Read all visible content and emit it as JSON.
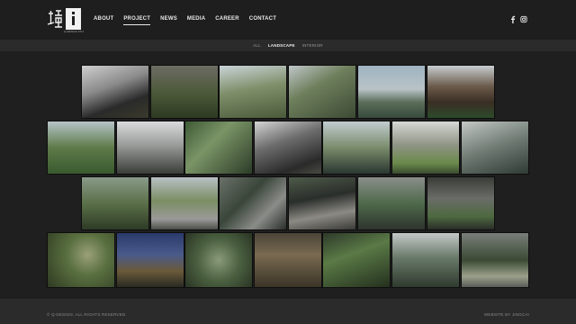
{
  "header": {
    "logo_subtext": "Q-DESIGN STUDIO",
    "nav": [
      {
        "label": "ABOUT",
        "active": false
      },
      {
        "label": "PROJECT",
        "active": true
      },
      {
        "label": "NEWS",
        "active": false
      },
      {
        "label": "MEDIA",
        "active": false
      },
      {
        "label": "CAREER",
        "active": false
      },
      {
        "label": "CONTACT",
        "active": false
      }
    ],
    "social": [
      "facebook-icon",
      "instagram-icon"
    ]
  },
  "filters": [
    {
      "label": "ALL",
      "active": false
    },
    {
      "label": "LANDSCAPE",
      "active": true
    },
    {
      "label": "INTERIOR",
      "active": false
    }
  ],
  "gallery": {
    "rows": [
      [
        {
          "name": "project-tile-1",
          "bg": "linear-gradient(160deg,#cfcfcf 0%,#8a8a8a 40%,#2a2a2a 70%,#3a3a2c 100%)"
        },
        {
          "name": "project-tile-2",
          "bg": "linear-gradient(180deg,#6c6c64 0%,#4d5a3a 50%,#2d3a22 100%)"
        },
        {
          "name": "project-tile-3",
          "bg": "linear-gradient(170deg,#c9d4d8 0%,#7f8f6a 45%,#4a5a3a 100%)"
        },
        {
          "name": "project-tile-4",
          "bg": "linear-gradient(150deg,#bfc6c8 0%,#6e7f5c 40%,#3c4a34 100%)"
        },
        {
          "name": "project-tile-5",
          "bg": "linear-gradient(180deg,#9fb3c2 0%,#b8c3c6 45%,#5a6e5a 70%,#384a3c 100%)"
        },
        {
          "name": "project-tile-6",
          "bg": "linear-gradient(180deg,#c7cdd0 0%,#6a5a4a 40%,#3a2e24 70%,#2d4a2a 100%)"
        }
      ],
      [
        {
          "name": "project-tile-7",
          "bg": "linear-gradient(180deg,#b6c4c8 0%,#5e7a4a 50%,#3a5a2e 100%)"
        },
        {
          "name": "project-tile-8",
          "bg": "linear-gradient(180deg,#d9dcdc 0%,#9a9c9a 45%,#3a3c38 100%)"
        },
        {
          "name": "project-tile-9",
          "bg": "linear-gradient(135deg,#3e5a36 0%,#7a9466 40%,#2c3c28 100%)"
        },
        {
          "name": "project-tile-10",
          "bg": "linear-gradient(160deg,#d4d4d4 0%,#6c6c6c 40%,#2a2a2a 80%,#4a4a44 100%)"
        },
        {
          "name": "project-tile-11",
          "bg": "linear-gradient(180deg,#c2ccd0 0%,#7a8c6c 50%,#2a3630 100%)"
        },
        {
          "name": "project-tile-12",
          "bg": "linear-gradient(180deg,#d6d8d4 0%,#8f9486 45%,#6a8a4a 80%,#3a4a30 100%)"
        },
        {
          "name": "project-tile-13",
          "bg": "linear-gradient(160deg,#c4c8c6 0%,#6e7a72 50%,#2e3a34 100%)"
        }
      ],
      [
        {
          "name": "project-tile-14",
          "bg": "linear-gradient(180deg,#8a9a8a 0%,#5a7048 50%,#2e3a26 100%)"
        },
        {
          "name": "project-tile-15",
          "bg": "linear-gradient(180deg,#b8c0c4 0%,#7a8e64 45%,#9a9a98 80%,#4a4e48 100%)"
        },
        {
          "name": "project-tile-16",
          "bg": "linear-gradient(135deg,#6a7068 0%,#3a463a 40%,#8a8c88 70%,#2a2e2a 100%)"
        },
        {
          "name": "project-tile-17",
          "bg": "linear-gradient(170deg,#4e5a4a 0%,#2a2e2a 40%,#8c8a84 70%,#3a3a36 100%)"
        },
        {
          "name": "project-tile-18",
          "bg": "linear-gradient(180deg,#8a8e8a 0%,#4e6a4a 50%,#2e342e 100%)"
        },
        {
          "name": "project-tile-19",
          "bg": "linear-gradient(180deg,#3a3c38 0%,#6a6c68 40%,#4e6a40 75%,#2a2c28 100%)"
        }
      ],
      [
        {
          "name": "project-tile-20",
          "bg": "radial-gradient(circle at 60% 40%,#9aa07a 0%,#5a7040 40%,#2e3a22 100%)"
        },
        {
          "name": "project-tile-21",
          "bg": "linear-gradient(180deg,#2a3a6a 0%,#4a5a8a 40%,#6a5a3a 70%,#2a2a22 100%)"
        },
        {
          "name": "project-tile-22",
          "bg": "radial-gradient(circle at 50% 50%,#8a9a7a 0%,#4a6040 50%,#2a3424 100%)"
        },
        {
          "name": "project-tile-23",
          "bg": "linear-gradient(180deg,#4a4438 0%,#7a6a50 40%,#3a3428 100%)"
        },
        {
          "name": "project-tile-24",
          "bg": "linear-gradient(160deg,#2e3a2a 0%,#5a7a46 40%,#24301e 100%)"
        },
        {
          "name": "project-tile-25",
          "bg": "linear-gradient(180deg,#c4c8c8 0%,#6a7a6a 45%,#2e3a2e 100%)"
        },
        {
          "name": "project-tile-26",
          "bg": "linear-gradient(180deg,#7a7e7a 0%,#3a4a34 50%,#9aa08a 80%,#5a5c58 100%)"
        }
      ]
    ]
  },
  "footer": {
    "copyright": "© Q-DESIGN. ALL RIGHTS RESERVED.",
    "credit": "WEBSITE BY JINGCAI"
  }
}
